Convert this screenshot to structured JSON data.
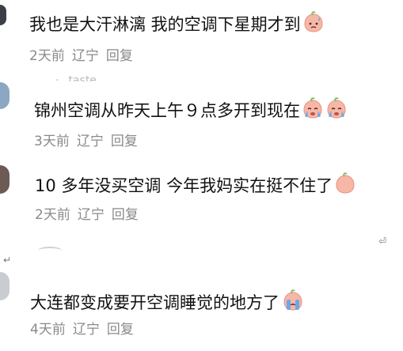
{
  "comments": [
    {
      "text": "我也是大汗淋漓 我的空调下星期才到",
      "time": "2天前",
      "location": "辽宁",
      "reply_label": "回复",
      "emoji": "sweating-peach-emoji"
    },
    {
      "partial_username": "taste",
      "text": "锦州空调从昨天上午９点多开到现在",
      "time": "3天前",
      "location": "辽宁",
      "reply_label": "回复",
      "emoji": "crying-peach-emoji"
    },
    {
      "text": "10 多年没买空调  今年我妈实在挺不住了",
      "time": "2天前",
      "location": "辽宁",
      "reply_label": "回复",
      "emoji": "peach-emoji"
    },
    {
      "text": "大连都变成要开空调睡觉的地方了",
      "time": "4天前",
      "location": "辽宁",
      "reply_label": "回复",
      "emoji": "sobbing-peach-emoji"
    }
  ],
  "colors": {
    "text": "#111111",
    "meta": "#8a8a8a",
    "emoji_peach": "#f7b7a7",
    "emoji_leaf": "#7fbf6a",
    "emoji_tear": "#6aa9e8"
  }
}
